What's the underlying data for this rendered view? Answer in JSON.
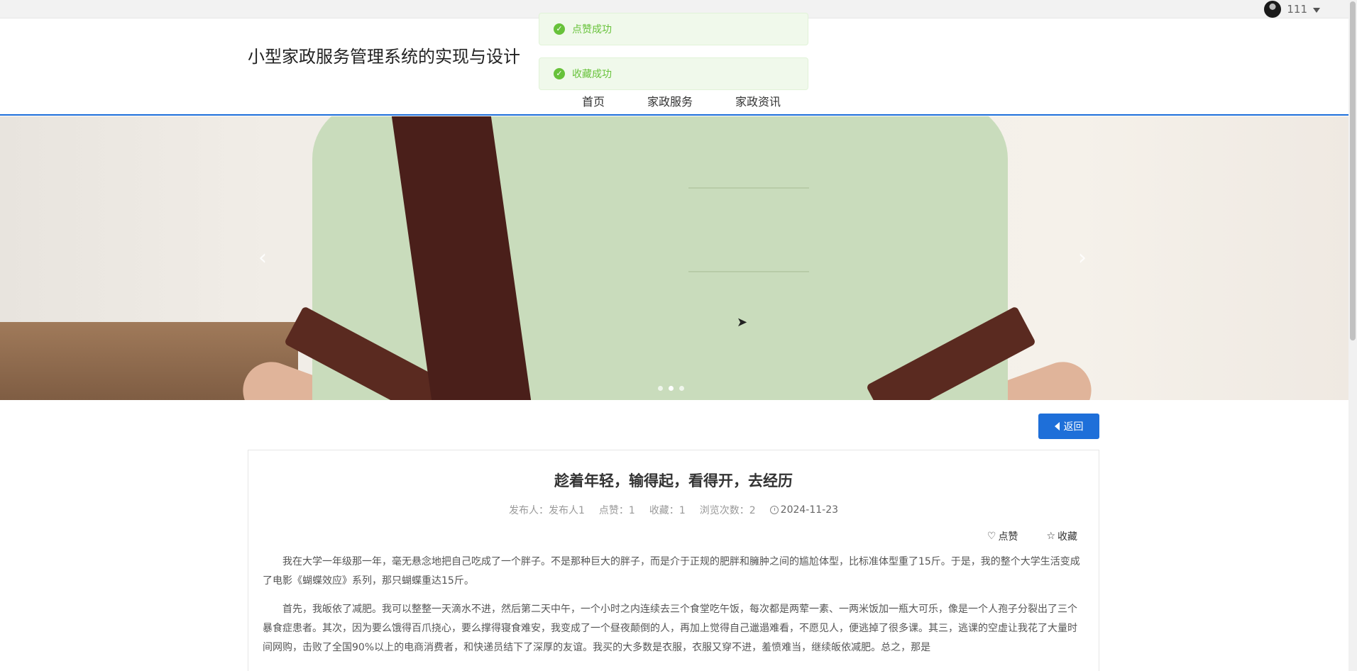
{
  "topbar": {
    "username": "111"
  },
  "header": {
    "site_title": "小型家政服务管理系统的实现与设计",
    "nav": [
      {
        "label": "首页"
      },
      {
        "label": "家政服务"
      },
      {
        "label": "家政资讯"
      }
    ]
  },
  "toasts": [
    {
      "text": "点赞成功"
    },
    {
      "text": "收藏成功"
    }
  ],
  "carousel": {
    "slide_count": 3,
    "active_index": 1
  },
  "back_button": {
    "label": "返回"
  },
  "article": {
    "title": "趁着年轻，输得起，看得开，去经历",
    "meta": {
      "publisher_label": "发布人：",
      "publisher": "发布人1",
      "likes_label": "点赞：",
      "likes": "1",
      "favorites_label": "收藏：",
      "favorites": "1",
      "views_label": "浏览次数：",
      "views": "2",
      "date": "2024-11-23"
    },
    "like_label": "点赞",
    "favorite_label": "收藏",
    "paragraphs": [
      "我在大学一年级那一年，毫无悬念地把自己吃成了一个胖子。不是那种巨大的胖子，而是介于正规的肥胖和臃肿之间的尴尬体型，比标准体型重了15斤。于是，我的整个大学生活变成了电影《蝴蝶效应》系列，那只蝴蝶重达15斤。",
      "首先，我皈依了减肥。我可以整整一天滴水不进，然后第二天中午，一个小时之内连续去三个食堂吃午饭，每次都是两荤一素、一两米饭加一瓶大可乐，像是一个人孢子分裂出了三个暴食症患者。其次，因为要么饿得百爪挠心，要么撑得寝食难安，我变成了一个昼夜颠倒的人，再加上觉得自己邋遢难看，不愿见人，便逃掉了很多课。其三，逃课的空虚让我花了大量时间网购，击败了全国90%以上的电商消费者，和快递员结下了深厚的友谊。我买的大多数是衣服，衣服又穿不进，羞愤难当，继续皈依减肥。总之，那是"
    ]
  }
}
